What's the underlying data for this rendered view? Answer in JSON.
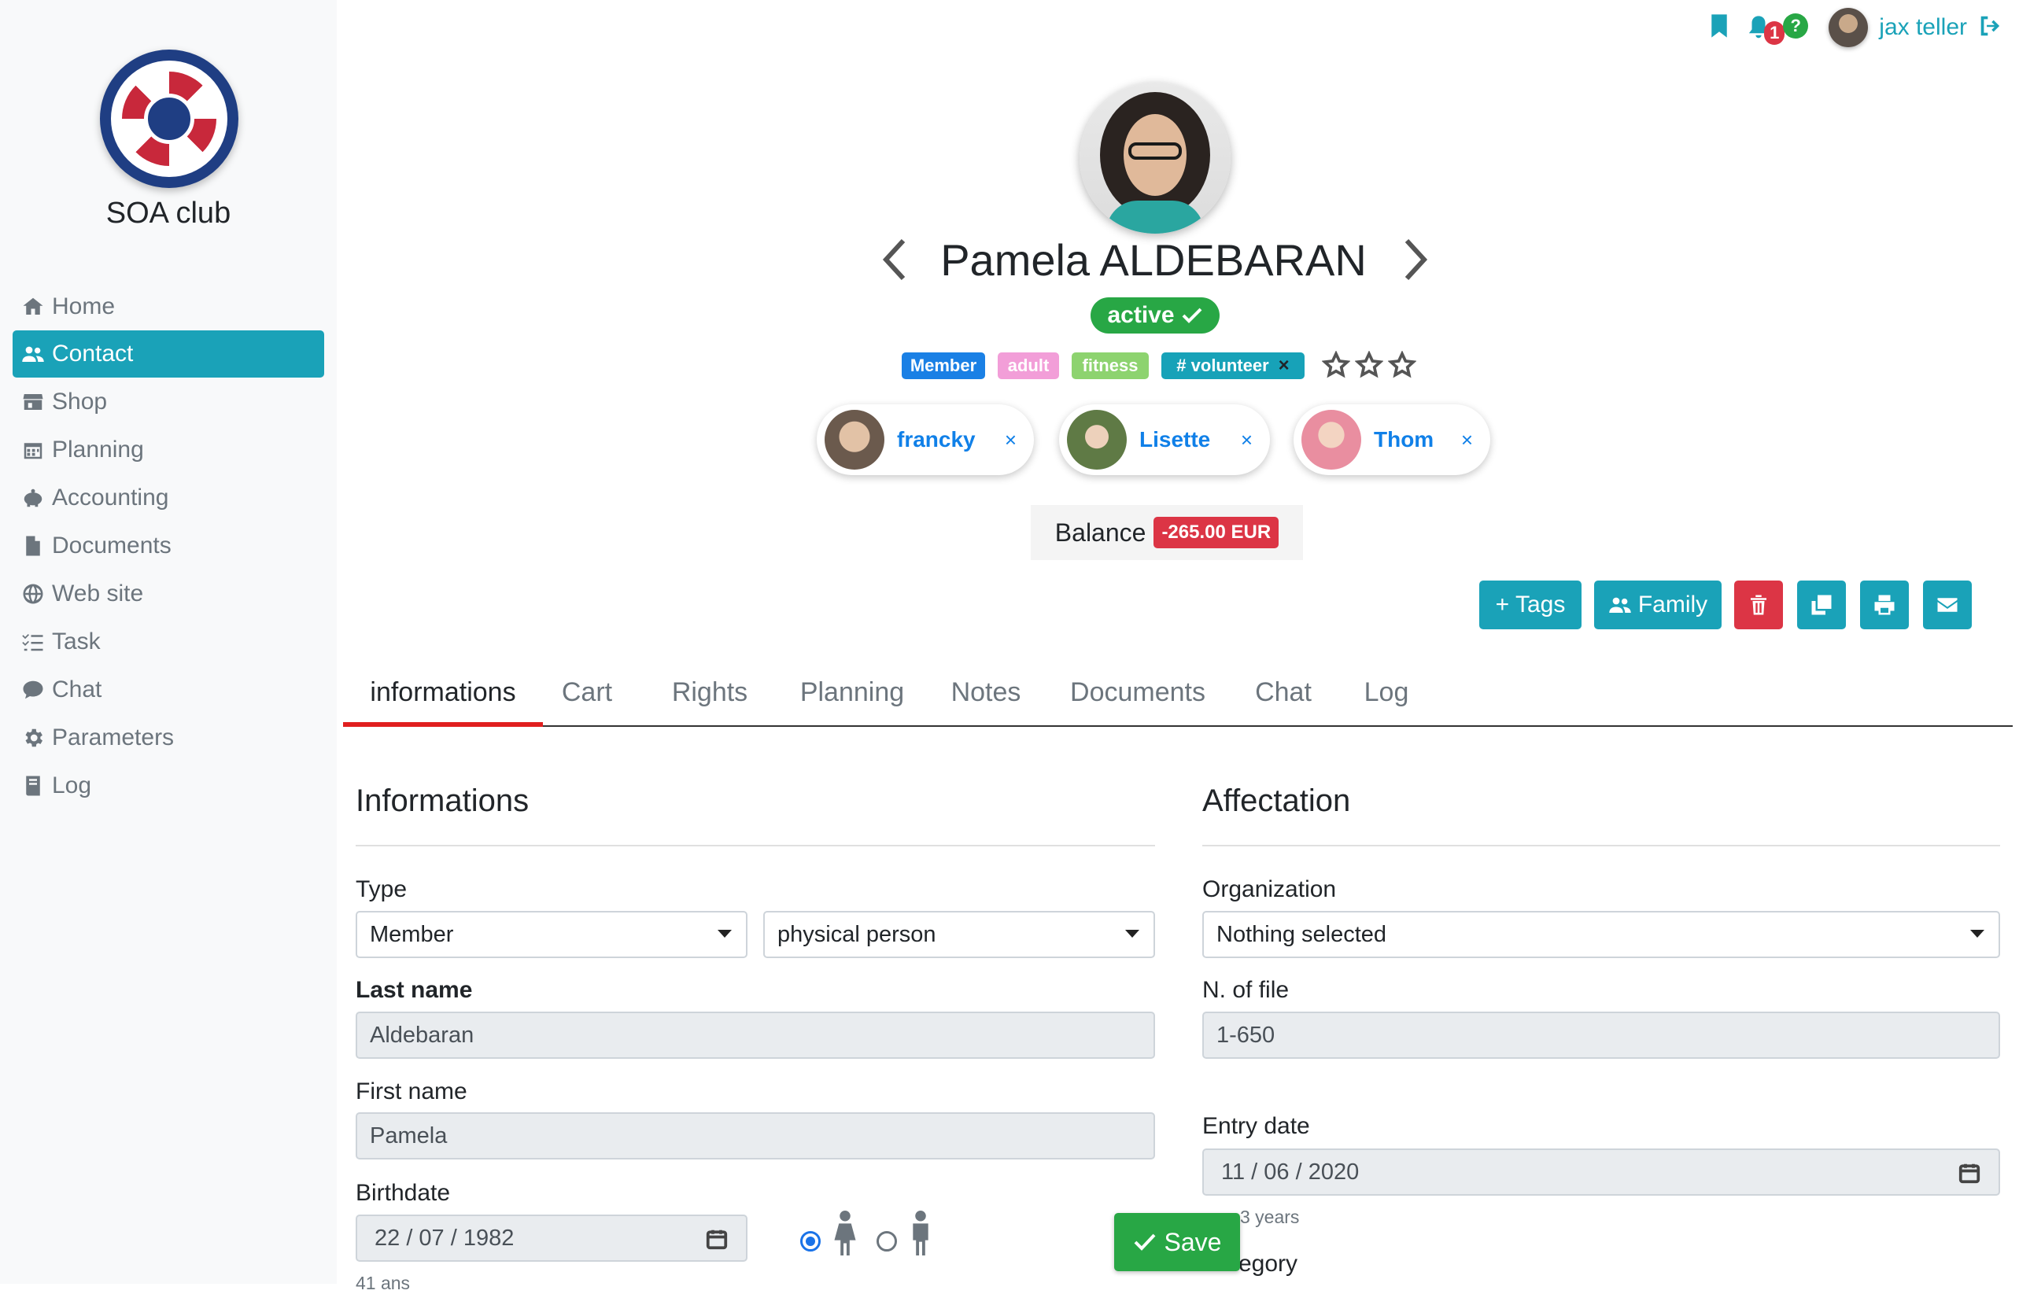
{
  "sidebar": {
    "club_name": "SOA club",
    "items": [
      {
        "label": "Home",
        "icon": "home-icon"
      },
      {
        "label": "Contact",
        "icon": "users-icon"
      },
      {
        "label": "Shop",
        "icon": "store-icon"
      },
      {
        "label": "Planning",
        "icon": "calendar-icon"
      },
      {
        "label": "Accounting",
        "icon": "piggy-bank-icon"
      },
      {
        "label": "Documents",
        "icon": "file-icon"
      },
      {
        "label": "Web site",
        "icon": "globe-icon"
      },
      {
        "label": "Task",
        "icon": "tasks-icon"
      },
      {
        "label": "Chat",
        "icon": "comment-icon"
      },
      {
        "label": "Parameters",
        "icon": "gear-icon"
      },
      {
        "label": "Log",
        "icon": "book-icon"
      }
    ],
    "active_index": 1
  },
  "topbar": {
    "notification_count": "1",
    "help_badge": "?",
    "user_name": "jax teller"
  },
  "contact": {
    "name": "Pamela ALDEBARAN",
    "status": "active",
    "tags": [
      {
        "label": "Member",
        "color": "#1a80e5"
      },
      {
        "label": "adult",
        "color": "#f29ed8"
      },
      {
        "label": "fitness",
        "color": "#8dd36f"
      },
      {
        "label": "# volunteer",
        "color": "#17a2b8",
        "remove": "×"
      }
    ],
    "rating": 0,
    "rating_max": 3,
    "family": [
      {
        "name": "francky",
        "remove": "×"
      },
      {
        "name": "Lisette",
        "remove": "×"
      },
      {
        "name": "Thom",
        "remove": "×"
      }
    ],
    "balance_label": "Balance",
    "balance_value": "-265.00 EUR"
  },
  "actions": {
    "tags_label": "+ Tags",
    "family_label": "Family"
  },
  "tabs": [
    "informations",
    "Cart",
    "Rights",
    "Planning",
    "Notes",
    "Documents",
    "Chat",
    "Log"
  ],
  "active_tab": "informations",
  "informations": {
    "title": "Informations",
    "type_label": "Type",
    "type_value": "Member",
    "person_kind": "physical person",
    "last_name_label": "Last name",
    "last_name": "Aldebaran",
    "first_name_label": "First name",
    "first_name": "Pamela",
    "birthdate_label": "Birthdate",
    "birthdate": "22 / 07 / 1982",
    "age_hint": "41 ans"
  },
  "affectation": {
    "title": "Affectation",
    "organization_label": "Organization",
    "organization_value": "Nothing selected",
    "file_label": "N. of file",
    "file_value": "1-650",
    "entry_label": "Entry date",
    "entry_value": "11 / 06 / 2020",
    "entry_hint": "3 years",
    "category_label": "egory"
  },
  "save_label": "Save",
  "colors": {
    "accent": "#1aa2b8",
    "danger": "#dc3545",
    "success": "#28a745",
    "tab_indicator": "#e01f1f"
  }
}
